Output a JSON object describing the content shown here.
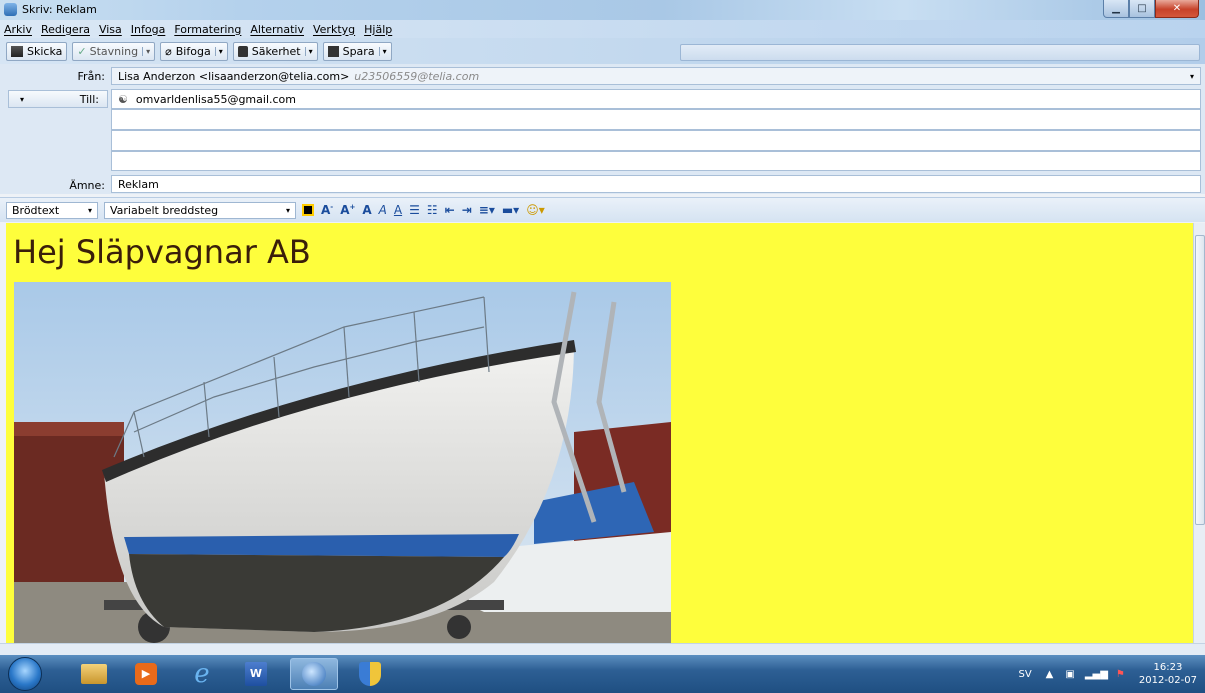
{
  "window": {
    "title": "Skriv: Reklam",
    "controls": [
      "minimize",
      "maximize",
      "close"
    ]
  },
  "menubar": [
    "Arkiv",
    "Redigera",
    "Visa",
    "Infoga",
    "Formatering",
    "Alternativ",
    "Verktyg",
    "Hjälp"
  ],
  "toolbar": {
    "send": "Skicka",
    "spelling": "Stavning",
    "attach": "Bifoga",
    "security": "Säkerhet",
    "save": "Spara"
  },
  "header": {
    "from_label": "Från:",
    "from_value": "Lisa Anderzon <lisaanderzon@telia.com>",
    "from_account": "u23506559@telia.com",
    "to_label": "Till:",
    "to_value": "omvarldenlisa55@gmail.com",
    "subject_label": "Ämne:",
    "subject_value": "Reklam"
  },
  "format": {
    "paragraph_style": "Brödtext",
    "font": "Variabelt breddsteg"
  },
  "body": {
    "greeting": "Hej Släpvagnar AB",
    "background_color": "#fefe3c",
    "image": "sailboat-photo"
  },
  "taskbar": {
    "apps": [
      "explorer-icon",
      "media-player-icon",
      "internet-explorer-icon",
      "word-icon",
      "thunderbird-icon",
      "security-center-icon"
    ],
    "lang": "SV",
    "time": "16:23",
    "date": "2012-02-07"
  }
}
